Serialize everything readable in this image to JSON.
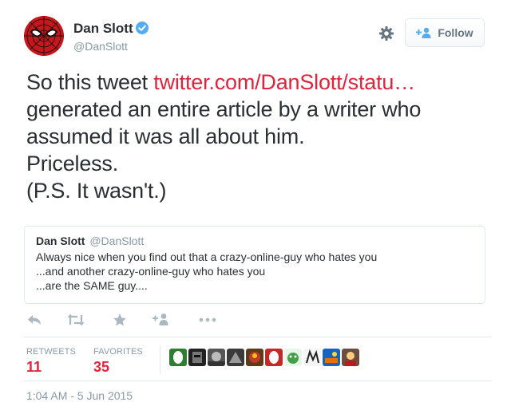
{
  "author": {
    "display_name": "Dan Slott",
    "handle": "@DanSlott",
    "verified": true,
    "avatar_icon": "spiderman-mask-avatar"
  },
  "header": {
    "follow_label": "Follow",
    "settings_icon": "gear-icon"
  },
  "tweet": {
    "line1_prefix": "So this tweet ",
    "link_text": "twitter.com/DanSlott/statu…",
    "line2": "generated an entire article by a writer who",
    "line3": "assumed it was all about him.",
    "line4": "Priceless.",
    "line5": "(P.S. It wasn't.)"
  },
  "quote": {
    "display_name": "Dan Slott",
    "handle": "@DanSlott",
    "lines": [
      "Always nice when you find out that a crazy-online-guy who hates you",
      "...and another crazy-online-guy who hates you",
      "...are the SAME guy...."
    ]
  },
  "actions": [
    "reply-icon",
    "retweet-icon",
    "favorite-star-icon",
    "follow-plus-icon",
    "more-dots-icon"
  ],
  "stats": {
    "retweets_label": "RETWEETS",
    "retweets_count": "11",
    "favorites_label": "FAVORITES",
    "favorites_count": "35"
  },
  "timestamp": "1:04 AM - 5 Jun 2015",
  "colors": {
    "link": "#e0243e",
    "muted": "#8899a6",
    "verified": "#55acee",
    "text": "#292f33",
    "border": "#e1e8ed"
  }
}
